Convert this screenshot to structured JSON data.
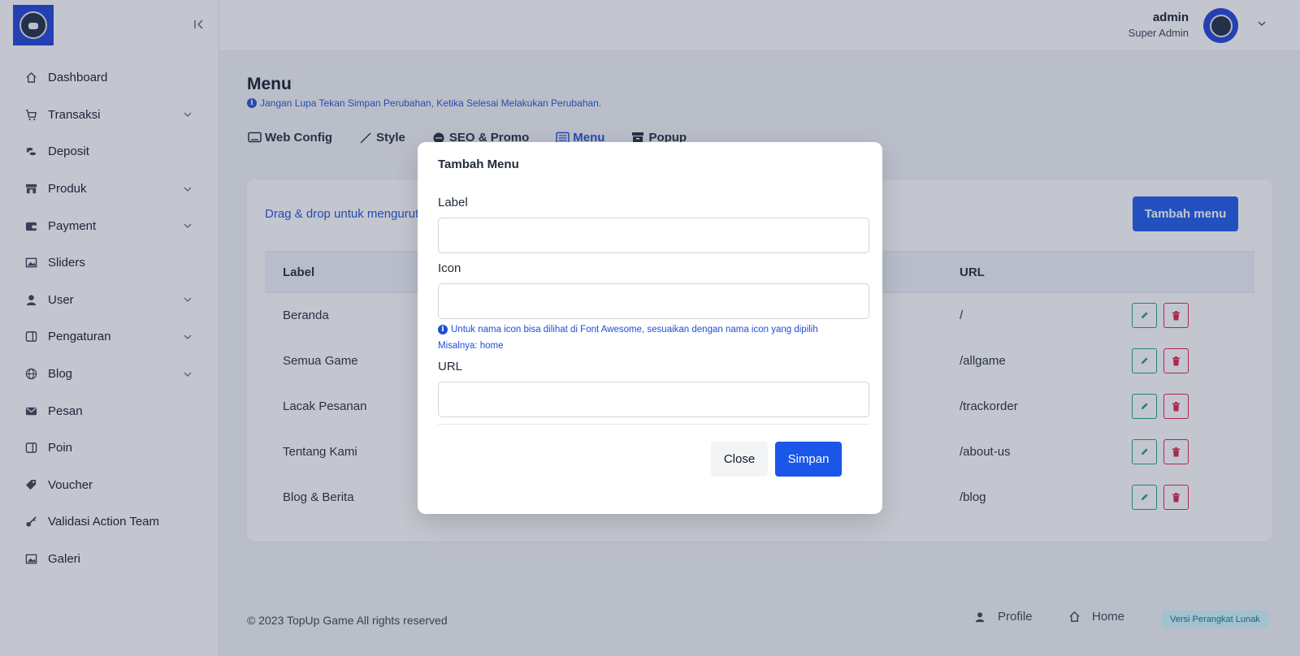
{
  "sidebar": {
    "items": [
      {
        "label": "Dashboard",
        "icon": "home-icon",
        "has_children": false
      },
      {
        "label": "Transaksi",
        "icon": "cart-icon",
        "has_children": true
      },
      {
        "label": "Deposit",
        "icon": "coins-icon",
        "has_children": false
      },
      {
        "label": "Produk",
        "icon": "store-icon",
        "has_children": true
      },
      {
        "label": "Payment",
        "icon": "wallet-icon",
        "has_children": true
      },
      {
        "label": "Sliders",
        "icon": "image-icon",
        "has_children": false
      },
      {
        "label": "User",
        "icon": "user-icon",
        "has_children": true
      },
      {
        "label": "Pengaturan",
        "icon": "panel-icon",
        "has_children": true
      },
      {
        "label": "Blog",
        "icon": "globe-icon",
        "has_children": true
      },
      {
        "label": "Pesan",
        "icon": "mail-icon",
        "has_children": false
      },
      {
        "label": "Poin",
        "icon": "panel-icon",
        "has_children": false
      },
      {
        "label": "Voucher",
        "icon": "tag-icon",
        "has_children": false
      },
      {
        "label": "Validasi Action Team",
        "icon": "key-icon",
        "has_children": false
      },
      {
        "label": "Galeri",
        "icon": "image-icon",
        "has_children": false
      }
    ]
  },
  "topbar": {
    "user_name": "admin",
    "user_role": "Super Admin"
  },
  "page": {
    "title": "Menu",
    "notice": "Jangan Lupa Tekan Simpan Perubahan, Ketika Selesai Melakukan Perubahan.",
    "tabs": [
      {
        "label": "Web Config",
        "active": false
      },
      {
        "label": "Style",
        "active": false
      },
      {
        "label": "SEO & Promo",
        "active": false
      },
      {
        "label": "Menu",
        "active": true
      },
      {
        "label": "Popup",
        "active": false
      }
    ]
  },
  "menu_table": {
    "drag_hint": "Drag & drop untuk mengurutkan menu",
    "add_button": "Tambah menu",
    "headers": {
      "label": "Label",
      "url": "URL"
    },
    "rows": [
      {
        "label": "Beranda",
        "url": "/"
      },
      {
        "label": "Semua Game",
        "url": "/allgame"
      },
      {
        "label": "Lacak Pesanan",
        "url": "/trackorder"
      },
      {
        "label": "Tentang Kami",
        "url": "/about-us"
      },
      {
        "label": "Blog & Berita",
        "url": "/blog"
      }
    ]
  },
  "footer": {
    "copyright": "© 2023 TopUp Game All rights reserved",
    "profile_link": "Profile",
    "home_link": "Home",
    "version_badge": "Versi Perangkat Lunak"
  },
  "modal": {
    "title": "Tambah Menu",
    "label_field": {
      "label": "Label",
      "value": "",
      "placeholder": ""
    },
    "icon_field": {
      "label": "Icon",
      "value": "",
      "placeholder": ""
    },
    "icon_hint_prefix": "Untuk nama icon bisa dilihat di Font Awesome, sesuaikan dengan nama icon yang dipilih",
    "icon_hint_example": "Misalnya: home",
    "url_field": {
      "label": "URL",
      "value": "",
      "placeholder": ""
    },
    "close_button": "Close",
    "save_button": "Simpan"
  },
  "colors": {
    "primary": "#1a56e8",
    "edit_green": "#16a085",
    "delete_red": "#e11d48"
  }
}
